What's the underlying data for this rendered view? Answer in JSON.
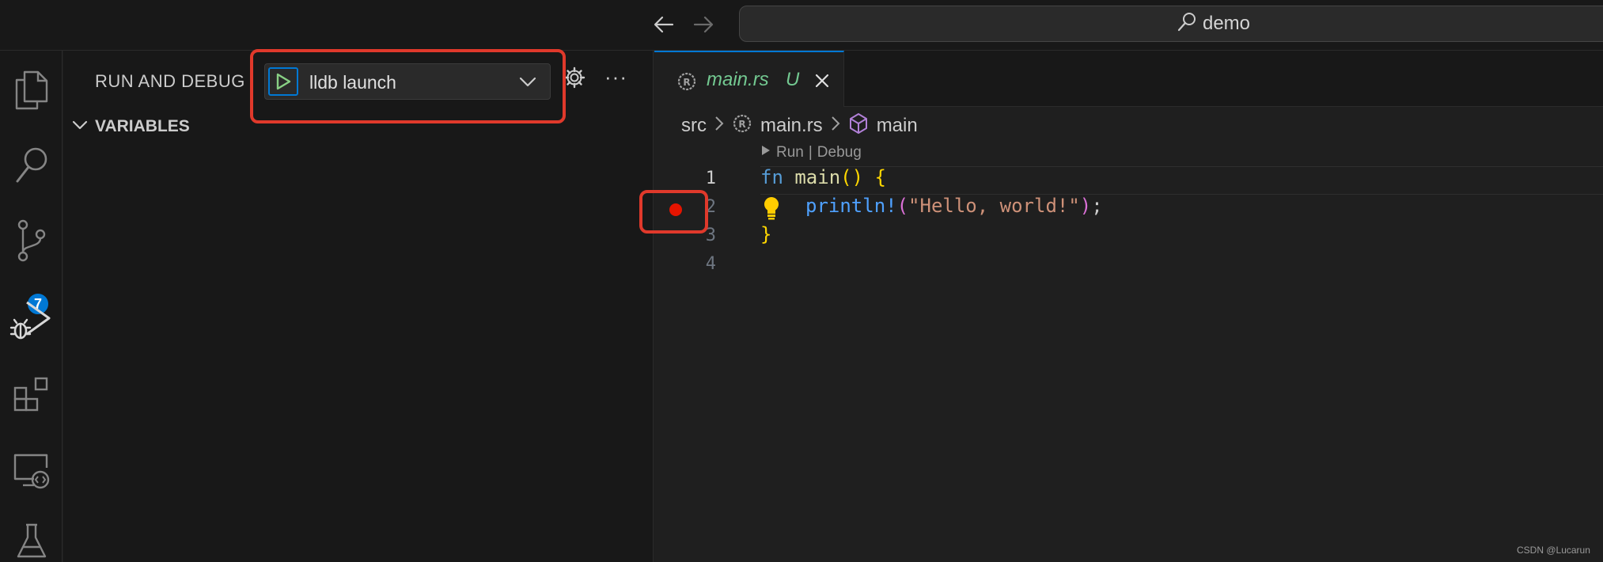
{
  "title_bar": {
    "search_label": "demo"
  },
  "activity_bar": {
    "icons": [
      "files-icon",
      "search-icon",
      "source-control-icon",
      "run-debug-icon",
      "extensions-icon",
      "remote-explorer-icon",
      "testing-icon"
    ],
    "source_control_badge": "7"
  },
  "sidebar": {
    "title": "RUN AND DEBUG",
    "debug_config": "lldb launch",
    "more_label": "···",
    "variables_section": "VARIABLES"
  },
  "editor": {
    "tab": {
      "name": "main.rs",
      "status": "U"
    },
    "breadcrumb": {
      "folder": "src",
      "file": "main.rs",
      "symbol": "main"
    },
    "codelens": {
      "run": "Run",
      "separator": "|",
      "debug": "Debug"
    },
    "line_numbers": [
      "1",
      "2",
      "3",
      "4"
    ],
    "breakpoint_line": 2,
    "code": {
      "line1": {
        "keyword": "fn",
        "name": "main",
        "parens": "()",
        "brace": "{"
      },
      "line2": {
        "macro": "println!",
        "open": "(",
        "string": "\"Hello, world!\"",
        "close": ")",
        "semi": ";"
      },
      "line3": {
        "brace": "}"
      }
    }
  },
  "watermark": "CSDN @Lucarun",
  "colors": {
    "accent": "#0078d4",
    "breakpoint": "#e51400",
    "highlight": "#e0392b",
    "untracked": "#73c991"
  }
}
